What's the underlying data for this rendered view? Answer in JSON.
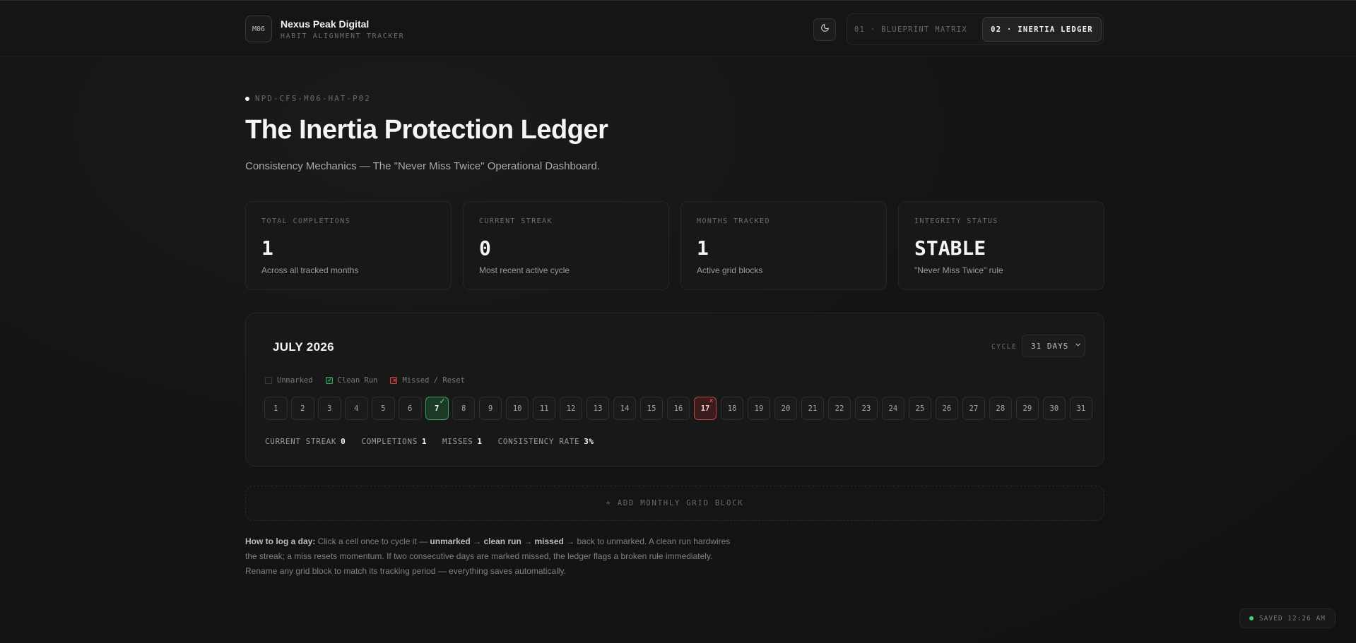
{
  "header": {
    "brand_badge": "M06",
    "brand_name": "Nexus Peak Digital",
    "brand_sub": "HABIT ALIGNMENT TRACKER",
    "theme_icon": "moon-icon",
    "tabs": [
      {
        "label": "01 · BLUEPRINT MATRIX",
        "active": false
      },
      {
        "label": "02 · INERTIA LEDGER",
        "active": true
      }
    ]
  },
  "hero": {
    "doc_id": "NPD-CFS-M06-HAT-P02",
    "title": "The Inertia Protection Ledger",
    "subtitle": "Consistency Mechanics — The \"Never Miss Twice\" Operational Dashboard."
  },
  "stats": [
    {
      "label": "TOTAL COMPLETIONS",
      "value": "1",
      "note": "Across all tracked months"
    },
    {
      "label": "CURRENT STREAK",
      "value": "0",
      "note": "Most recent active cycle"
    },
    {
      "label": "MONTHS TRACKED",
      "value": "1",
      "note": "Active grid blocks"
    },
    {
      "label": "INTEGRITY STATUS",
      "value": "STABLE",
      "note": "\"Never Miss Twice\" rule"
    }
  ],
  "grid": {
    "month": "JULY 2026",
    "cycle_label": "CYCLE",
    "cycle_value": "31 DAYS",
    "legend": {
      "unmarked": "Unmarked",
      "clean": "Clean Run",
      "missed": "Missed / Reset"
    },
    "days": [
      {
        "n": "1",
        "state": "unmarked"
      },
      {
        "n": "2",
        "state": "unmarked"
      },
      {
        "n": "3",
        "state": "unmarked"
      },
      {
        "n": "4",
        "state": "unmarked"
      },
      {
        "n": "5",
        "state": "unmarked"
      },
      {
        "n": "6",
        "state": "unmarked"
      },
      {
        "n": "7",
        "state": "clean"
      },
      {
        "n": "8",
        "state": "unmarked"
      },
      {
        "n": "9",
        "state": "unmarked"
      },
      {
        "n": "10",
        "state": "unmarked"
      },
      {
        "n": "11",
        "state": "unmarked"
      },
      {
        "n": "12",
        "state": "unmarked"
      },
      {
        "n": "13",
        "state": "unmarked"
      },
      {
        "n": "14",
        "state": "unmarked"
      },
      {
        "n": "15",
        "state": "unmarked"
      },
      {
        "n": "16",
        "state": "unmarked"
      },
      {
        "n": "17",
        "state": "missed"
      },
      {
        "n": "18",
        "state": "unmarked"
      },
      {
        "n": "19",
        "state": "unmarked"
      },
      {
        "n": "20",
        "state": "unmarked"
      },
      {
        "n": "21",
        "state": "unmarked"
      },
      {
        "n": "22",
        "state": "unmarked"
      },
      {
        "n": "23",
        "state": "unmarked"
      },
      {
        "n": "24",
        "state": "unmarked"
      },
      {
        "n": "25",
        "state": "unmarked"
      },
      {
        "n": "26",
        "state": "unmarked"
      },
      {
        "n": "27",
        "state": "unmarked"
      },
      {
        "n": "28",
        "state": "unmarked"
      },
      {
        "n": "29",
        "state": "unmarked"
      },
      {
        "n": "30",
        "state": "unmarked"
      },
      {
        "n": "31",
        "state": "unmarked"
      }
    ],
    "summary": {
      "streak_label": "CURRENT STREAK",
      "streak": "0",
      "completions_label": "COMPLETIONS",
      "completions": "1",
      "misses_label": "MISSES",
      "misses": "1",
      "rate_label": "CONSISTENCY RATE",
      "rate": "3%"
    }
  },
  "add_block_label": "+ ADD MONTHLY GRID BLOCK",
  "help": {
    "lead": "How to log a day:",
    "t1": " Click a cell once to cycle it — ",
    "b1": "unmarked",
    "t2": " → ",
    "b2": "clean run",
    "t3": " → ",
    "b3": "missed",
    "t4": " → back to unmarked. A clean run hardwires the streak; a miss resets momentum. If two consecutive days are marked missed, the ledger flags a broken rule immediately. Rename any grid block to match its tracking period — everything saves automatically."
  },
  "saved_status": "SAVED 12:26 AM",
  "colors": {
    "clean": "#3b9b60",
    "missed": "#b84545",
    "saved_dot": "#3fd27a"
  }
}
